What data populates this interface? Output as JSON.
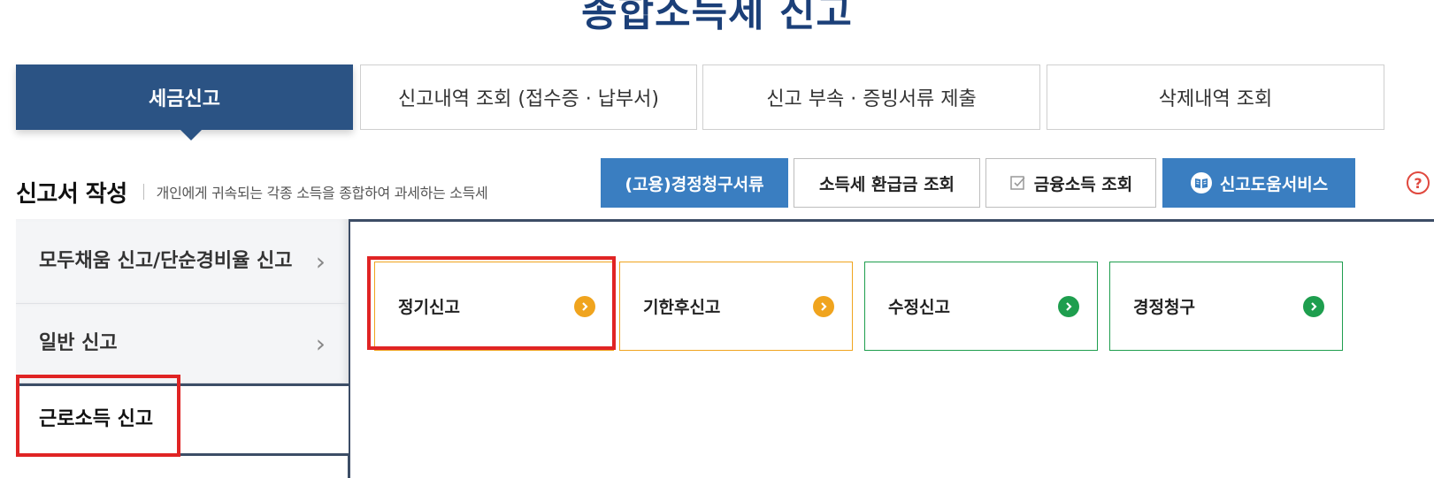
{
  "page": {
    "title": "종합소득세 신고"
  },
  "main_tabs": [
    {
      "label": "세금신고",
      "active": true
    },
    {
      "label": "신고내역 조회 (접수증 · 납부서)",
      "active": false
    },
    {
      "label": "신고 부속 · 증빙서류 제출",
      "active": false
    },
    {
      "label": "삭제내역 조회",
      "active": false
    }
  ],
  "section": {
    "title": "신고서 작성",
    "description": "개인에게 귀속되는 각종 소득을 종합하여 과세하는 소득세"
  },
  "actions": {
    "correction_claim_docs": "(고용)경정청구서류",
    "tax_refund_inquiry": "소득세 환급금 조회",
    "financial_income_inquiry": "금융소득 조회",
    "filing_help_service": "신고도움서비스",
    "help_icon": "?"
  },
  "left_nav": [
    {
      "label": "모두채움 신고/단순경비율 신고",
      "active": false,
      "chevron": "›"
    },
    {
      "label": "일반 신고",
      "active": false,
      "chevron": "›"
    },
    {
      "label": "근로소득 신고",
      "active": true
    }
  ],
  "filing_options": [
    {
      "label": "정기신고",
      "color": "#f0a41e"
    },
    {
      "label": "기한후신고",
      "color": "#f0a41e"
    },
    {
      "label": "수정신고",
      "color": "#1e9e4e"
    },
    {
      "label": "경정청구",
      "color": "#1e9e4e"
    }
  ],
  "colors": {
    "brand_navy": "#2b5384",
    "title_blue": "#1b3f78",
    "button_blue": "#3a7ec1",
    "highlight_red": "#e02424"
  },
  "icons": {
    "help": "question-circle-icon",
    "checkbox": "check-square-icon",
    "book": "book-icon",
    "chevron": "chevron-right-icon",
    "card_arrow": "arrow-right-circle-icon"
  }
}
